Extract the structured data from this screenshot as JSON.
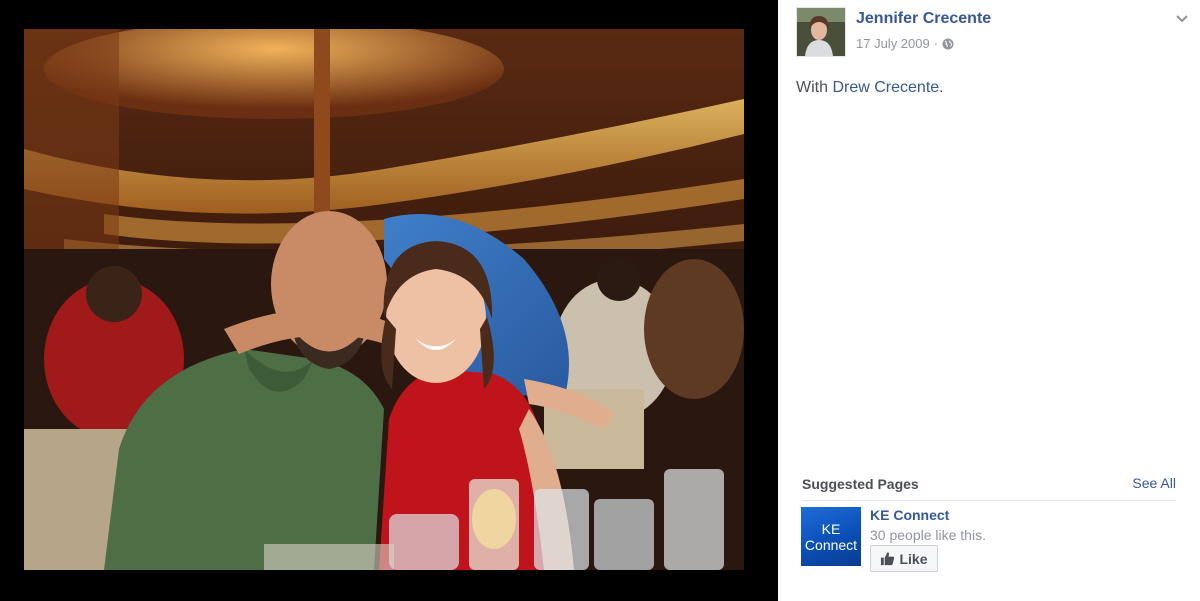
{
  "post": {
    "author": "Jennifer Crecente",
    "date": "17 July 2009",
    "separator": "·",
    "privacy_icon": "globe-icon",
    "menu_icon": "chevron-down-icon",
    "with_prefix": "With ",
    "tagged_person": "Drew Crecente",
    "with_suffix": "."
  },
  "suggested_pages": {
    "title": "Suggested Pages",
    "see_all": "See All",
    "items": [
      {
        "logo_line1": "KE",
        "logo_line2": "Connect",
        "name": "KE Connect",
        "likes_text": "30 people like this.",
        "like_label": "Like",
        "like_icon": "thumbs-up-icon"
      }
    ]
  },
  "colors": {
    "link_blue": "#365899",
    "meta_gray": "#90949c",
    "text_dark": "#4b4f56",
    "stage_black": "#000000",
    "logo_blue": "#1357c7"
  }
}
